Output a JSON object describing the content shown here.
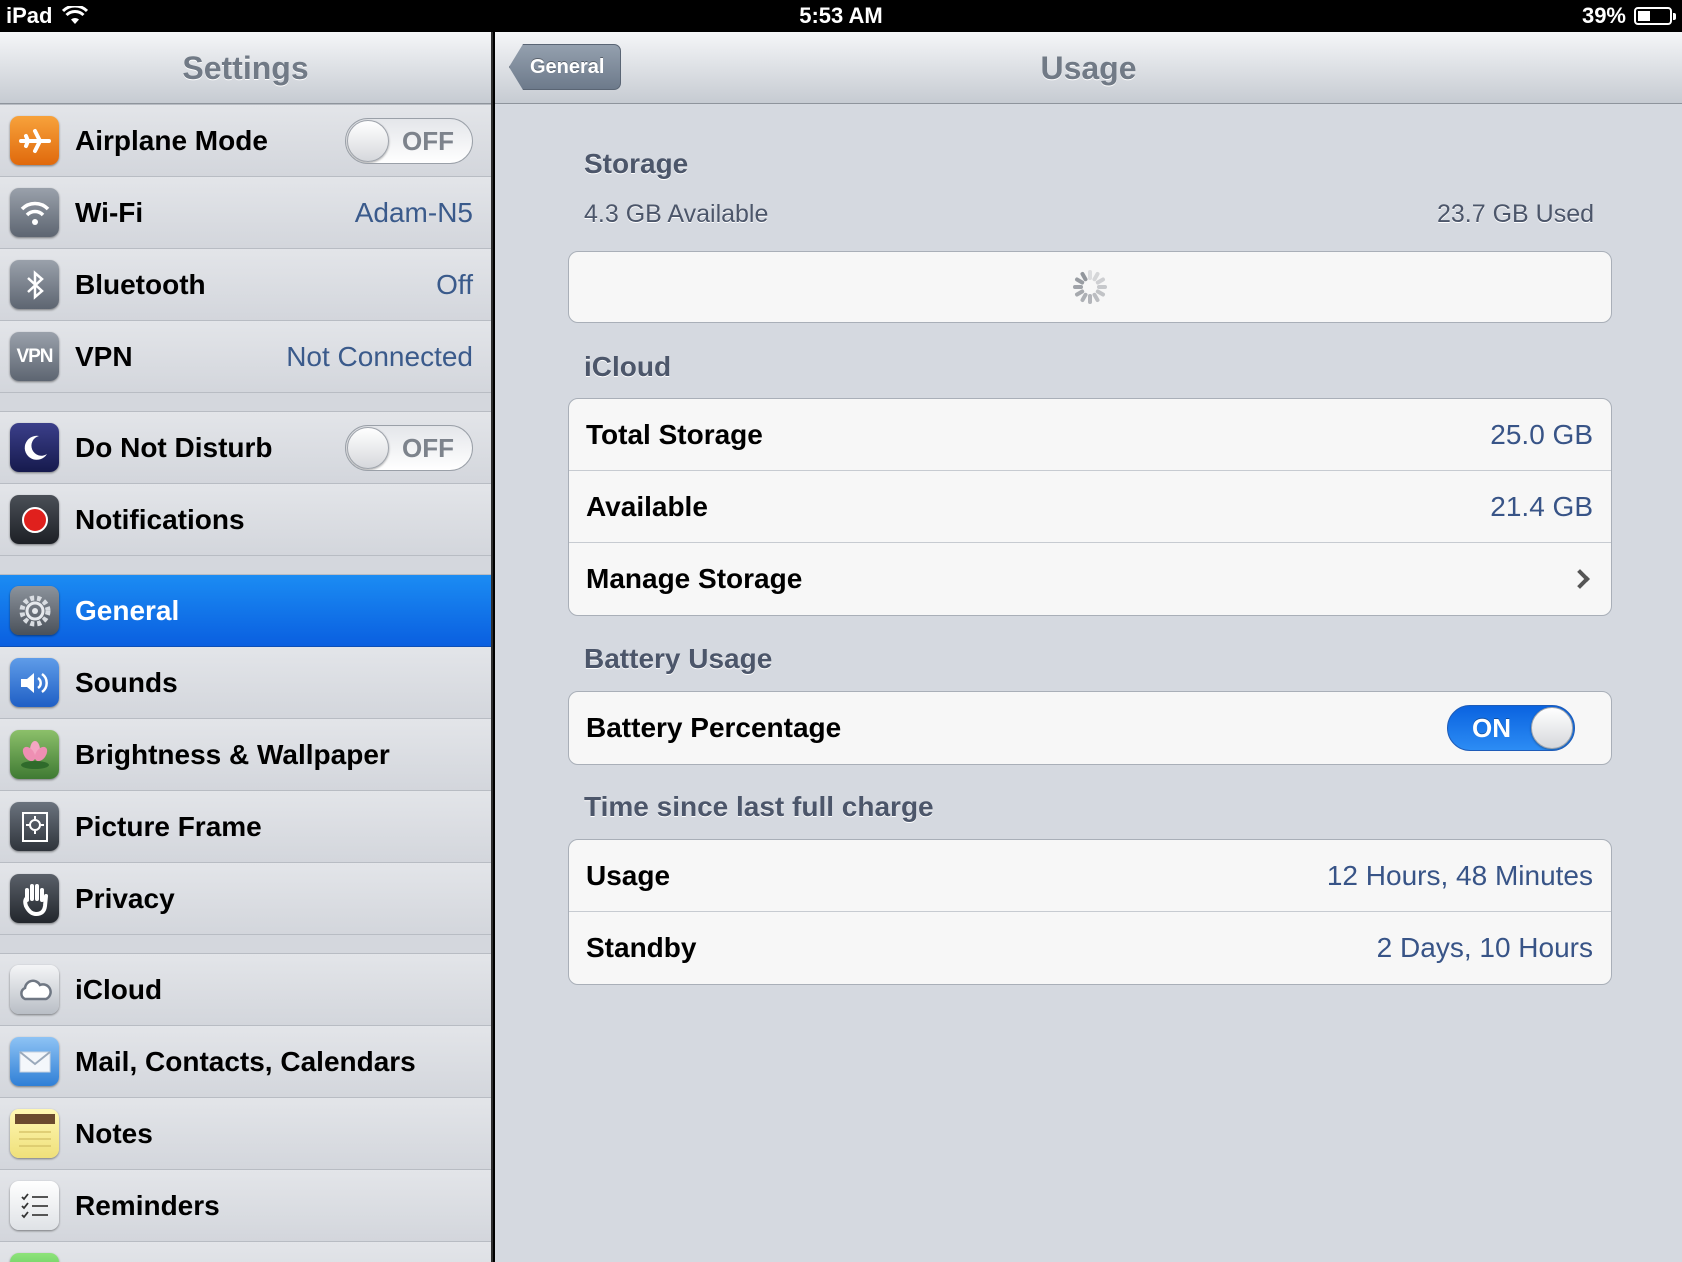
{
  "status_bar": {
    "device": "iPad",
    "time": "5:53 AM",
    "battery_text": "39%",
    "battery_level": 0.39
  },
  "master": {
    "title": "Settings",
    "groups": [
      [
        {
          "icon": "airplane-icon",
          "label": "Airplane Mode",
          "control": "toggle",
          "toggle_text": "OFF"
        },
        {
          "icon": "wifi-icon",
          "label": "Wi-Fi",
          "value": "Adam-N5"
        },
        {
          "icon": "bluetooth-icon",
          "label": "Bluetooth",
          "value": "Off"
        },
        {
          "icon": "vpn-icon",
          "icon_text": "VPN",
          "label": "VPN",
          "value": "Not Connected"
        }
      ],
      [
        {
          "icon": "moon-icon",
          "label": "Do Not Disturb",
          "control": "toggle",
          "toggle_text": "OFF"
        },
        {
          "icon": "notifications-icon",
          "label": "Notifications"
        }
      ],
      [
        {
          "icon": "gear-icon",
          "label": "General",
          "selected": true
        },
        {
          "icon": "speaker-icon",
          "label": "Sounds"
        },
        {
          "icon": "flower-icon",
          "label": "Brightness & Wallpaper"
        },
        {
          "icon": "picture-frame-icon",
          "label": "Picture Frame"
        },
        {
          "icon": "hand-icon",
          "label": "Privacy"
        }
      ],
      [
        {
          "icon": "cloud-icon",
          "label": "iCloud"
        },
        {
          "icon": "mail-icon",
          "label": "Mail, Contacts, Calendars"
        },
        {
          "icon": "notepad-icon",
          "label": "Notes"
        },
        {
          "icon": "checklist-icon",
          "label": "Reminders"
        },
        {
          "icon": "messages-icon",
          "label": ""
        }
      ]
    ]
  },
  "detail": {
    "title": "Usage",
    "back_label": "General",
    "storage": {
      "header": "Storage",
      "available": "4.3 GB Available",
      "used": "23.7 GB Used"
    },
    "icloud": {
      "header": "iCloud",
      "rows": [
        {
          "label": "Total Storage",
          "value": "25.0 GB"
        },
        {
          "label": "Available",
          "value": "21.4 GB"
        },
        {
          "label": "Manage Storage",
          "value": ""
        }
      ]
    },
    "battery": {
      "header": "Battery Usage",
      "row_label": "Battery Percentage",
      "toggle_text": "ON"
    },
    "charge": {
      "header": "Time since last full charge",
      "rows": [
        {
          "label": "Usage",
          "value": "12 Hours, 48 Minutes"
        },
        {
          "label": "Standby",
          "value": "2 Days, 10 Hours"
        }
      ]
    }
  },
  "colors": {
    "selected_row": "#0a6ae8",
    "value_text": "#385487",
    "toggle_on": "#1a78ee"
  }
}
